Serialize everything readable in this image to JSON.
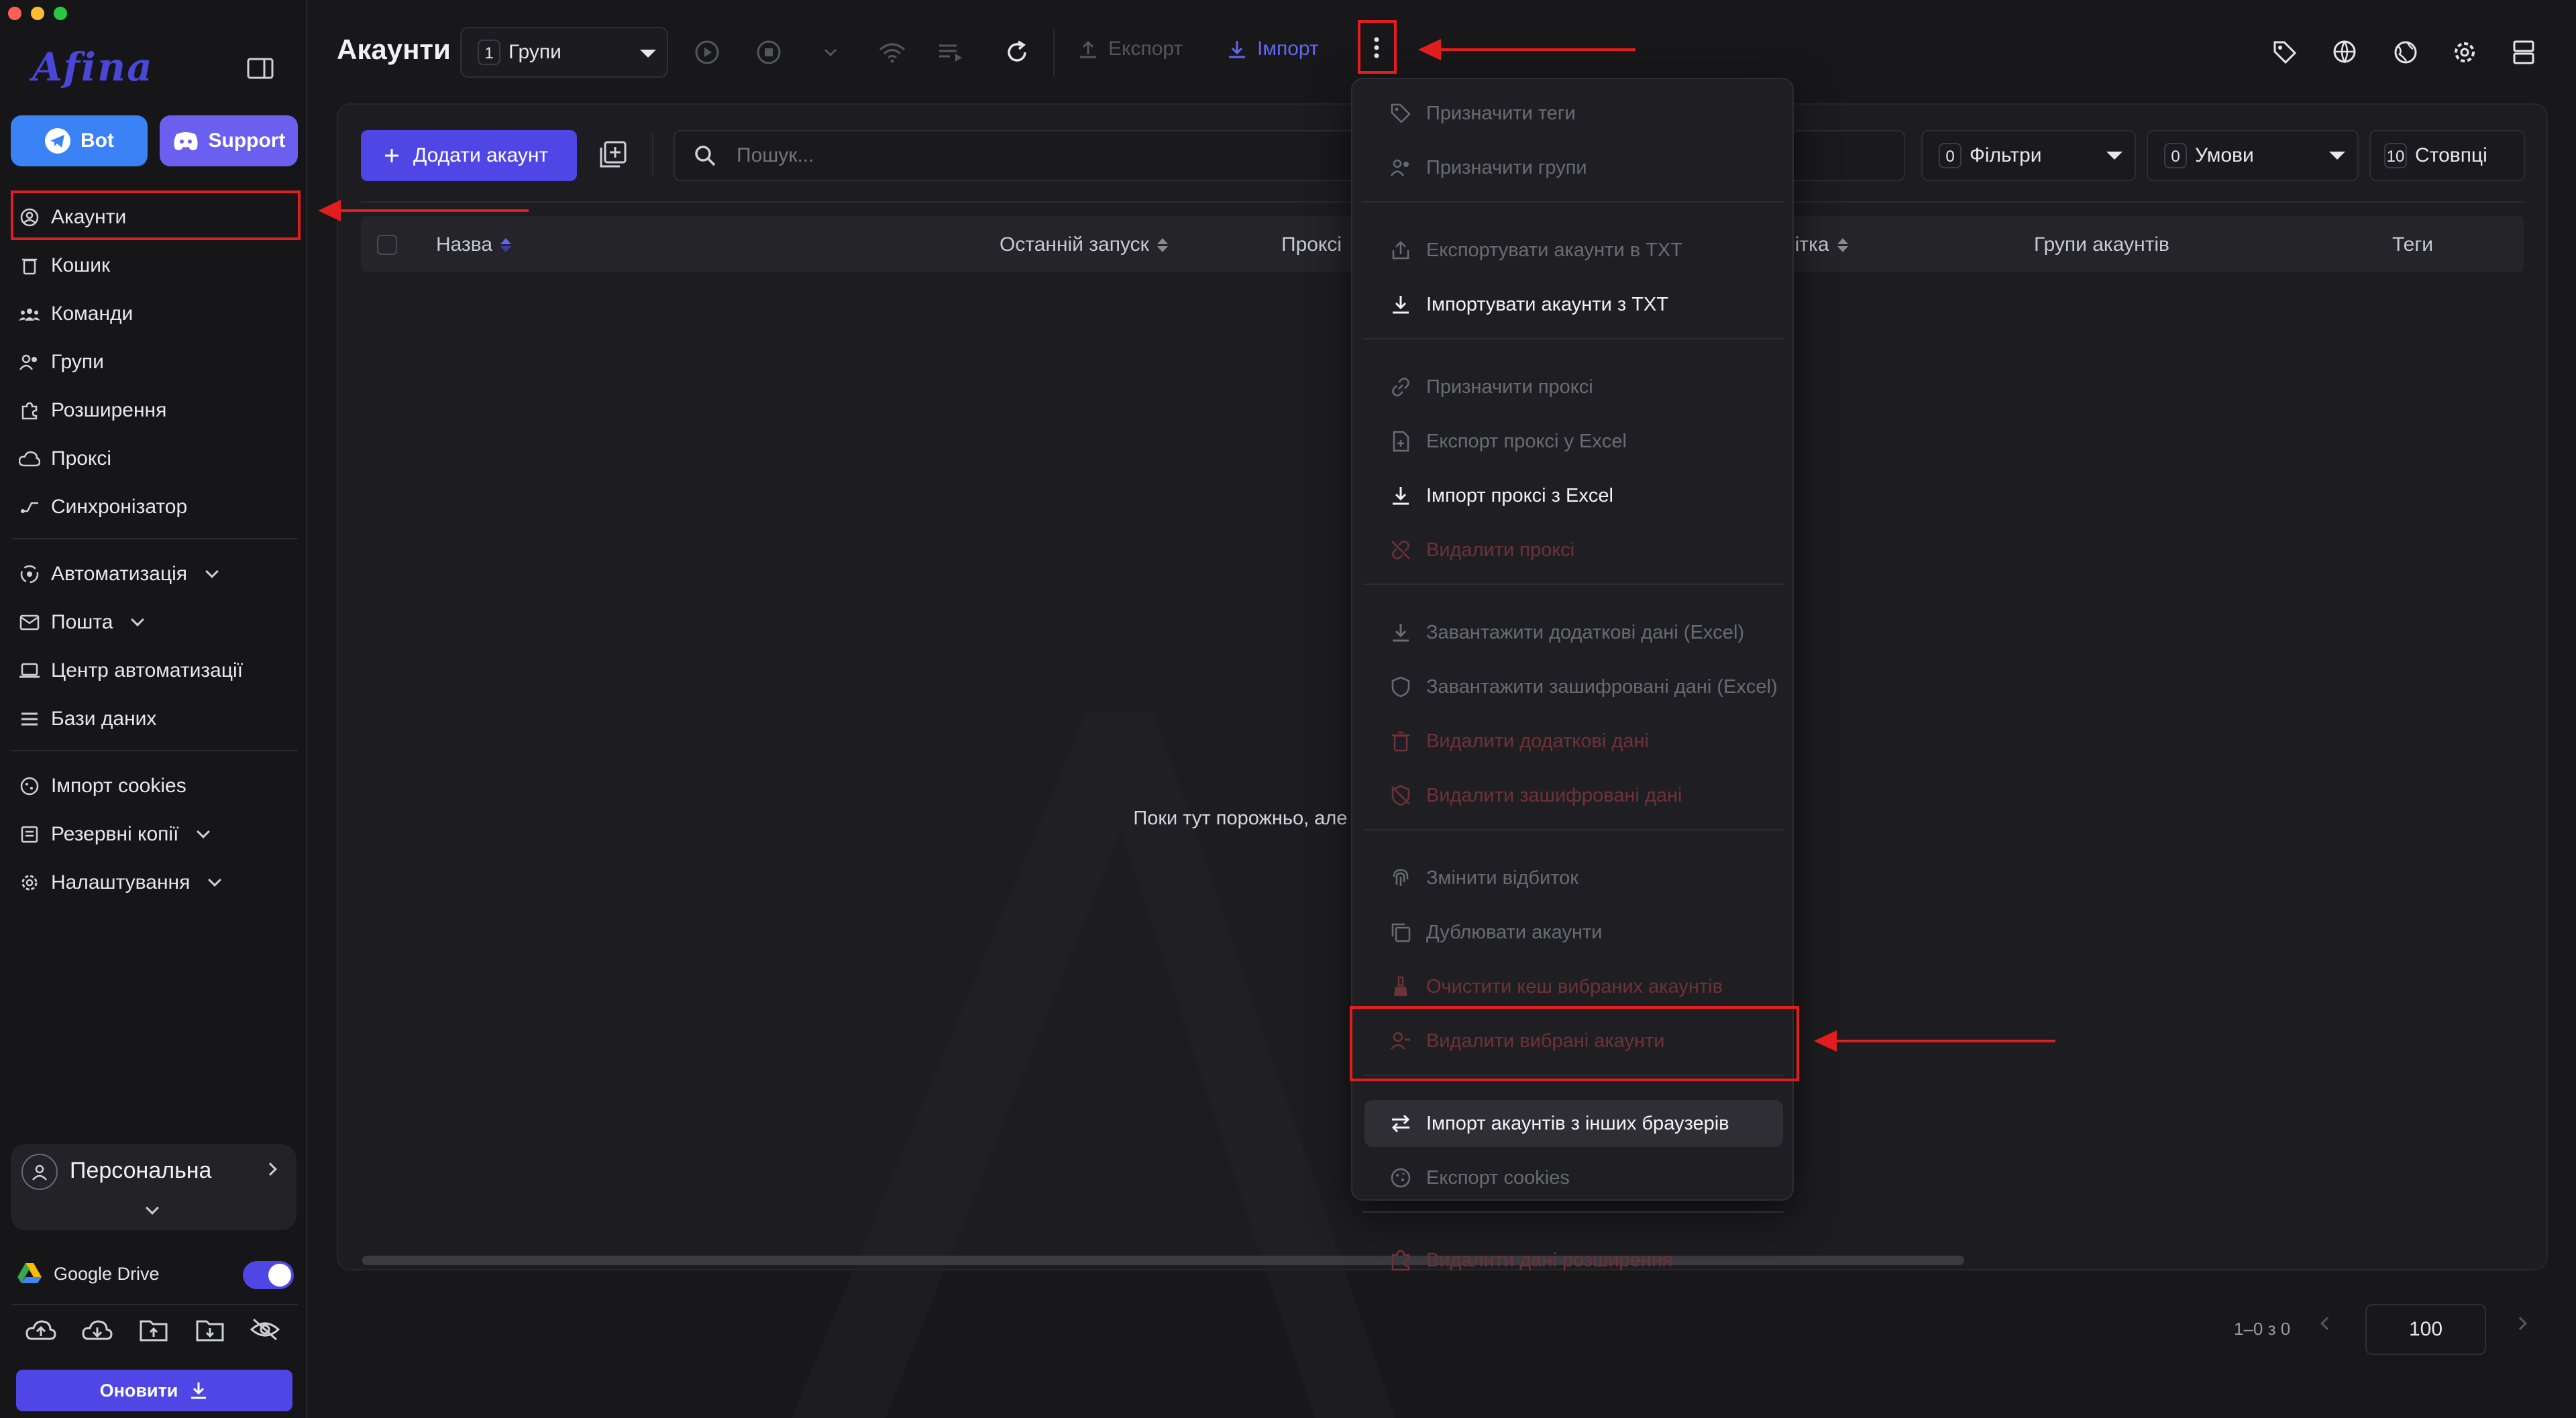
{
  "app": {
    "logo": "Afina"
  },
  "sidebar": {
    "bot_label": "Bot",
    "support_label": "Support",
    "nav_main": [
      {
        "label": "Акаунти",
        "icon": "user-circle-icon"
      },
      {
        "label": "Кошик",
        "icon": "trash-icon"
      },
      {
        "label": "Команди",
        "icon": "team-icon"
      },
      {
        "label": "Групи",
        "icon": "groups-icon"
      },
      {
        "label": "Розширення",
        "icon": "puzzle-icon"
      },
      {
        "label": "Проксі",
        "icon": "cloud-icon"
      },
      {
        "label": "Синхронізатор",
        "icon": "sync-icon"
      }
    ],
    "nav_auto": [
      {
        "label": "Автоматизація",
        "icon": "automation-icon"
      },
      {
        "label": "Пошта",
        "icon": "mail-icon"
      },
      {
        "label": "Центр автоматизації",
        "icon": "laptop-icon"
      },
      {
        "label": "Бази даних",
        "icon": "list-icon"
      }
    ],
    "nav_misc": [
      {
        "label": "Імпорт cookies",
        "icon": "cookie-icon"
      },
      {
        "label": "Резервні копії",
        "icon": "backup-icon"
      },
      {
        "label": "Налаштування",
        "icon": "gear-icon"
      }
    ],
    "workspace_label": "Персональна",
    "google_drive_label": "Google Drive",
    "google_drive_enabled": true,
    "update_label": "Оновити"
  },
  "header": {
    "title": "Акаунти",
    "groups_count": "1",
    "groups_label": "Групи",
    "export_label": "Експорт",
    "import_label": "Імпорт"
  },
  "toolbar": {
    "add_account_label": "Додати акаунт",
    "search_placeholder": "Пошук...",
    "filters_count": "0",
    "filters_label": "Фільтри",
    "conditions_count": "0",
    "conditions_label": "Умови",
    "columns_count": "10",
    "columns_label": "Стовпці"
  },
  "table": {
    "columns": [
      "Назва",
      "Останній запуск",
      "Проксі",
      "Примітка",
      "Групи акаунтів",
      "Теги"
    ],
    "empty_text": "Поки тут порожньо, але незабаром з'явиться ... пошуку або фільтри."
  },
  "pagination": {
    "range": "1–0 з 0",
    "page_size": "100"
  },
  "menu": {
    "groups": [
      [
        {
          "label": "Призначити теги",
          "state": "disabled",
          "icon": "tag-icon"
        },
        {
          "label": "Призначити групи",
          "state": "disabled",
          "icon": "groups-icon"
        }
      ],
      [
        {
          "label": "Експортувати акаунти в TXT",
          "state": "disabled",
          "icon": "export-icon"
        },
        {
          "label": "Імпортувати акаунти з TXT",
          "state": "active",
          "icon": "download-icon"
        }
      ],
      [
        {
          "label": "Призначити проксі",
          "state": "disabled",
          "icon": "link-icon"
        },
        {
          "label": "Експорт проксі у Excel",
          "state": "disabled",
          "icon": "file-add-icon"
        },
        {
          "label": "Імпорт проксі з Excel",
          "state": "active",
          "icon": "download-icon"
        },
        {
          "label": "Видалити проксі",
          "state": "danger",
          "icon": "link-off-icon"
        }
      ],
      [
        {
          "label": "Завантажити додаткові дані (Excel)",
          "state": "disabled",
          "icon": "download-icon"
        },
        {
          "label": "Завантажити зашифровані дані (Excel)",
          "state": "disabled",
          "icon": "shield-icon"
        },
        {
          "label": "Видалити додаткові дані",
          "state": "danger",
          "icon": "trash-icon"
        },
        {
          "label": "Видалити зашифровані дані",
          "state": "danger",
          "icon": "shield-off-icon"
        }
      ],
      [
        {
          "label": "Змінити відбиток",
          "state": "disabled",
          "icon": "fingerprint-icon"
        },
        {
          "label": "Дублювати акаунти",
          "state": "disabled",
          "icon": "copy-icon"
        },
        {
          "label": "Очистити кеш вибраних акаунтів",
          "state": "danger",
          "icon": "broom-icon"
        },
        {
          "label": "Видалити вибрані акаунти",
          "state": "danger",
          "icon": "user-remove-icon"
        }
      ],
      [
        {
          "label": "Імпорт акаунтів з інших браузерів",
          "state": "highlighted",
          "icon": "swap-icon"
        },
        {
          "label": "Експорт cookies",
          "state": "disabled",
          "icon": "cookie-icon"
        }
      ],
      [
        {
          "label": "Видалити дані розширення",
          "state": "danger",
          "icon": "puzzle-icon"
        }
      ]
    ]
  },
  "colors": {
    "accent": "#4f46e5",
    "telegram": "#3b82f6",
    "discord": "#6366f1",
    "annotation": "#e11d1d",
    "danger_text": "#6e3238"
  }
}
